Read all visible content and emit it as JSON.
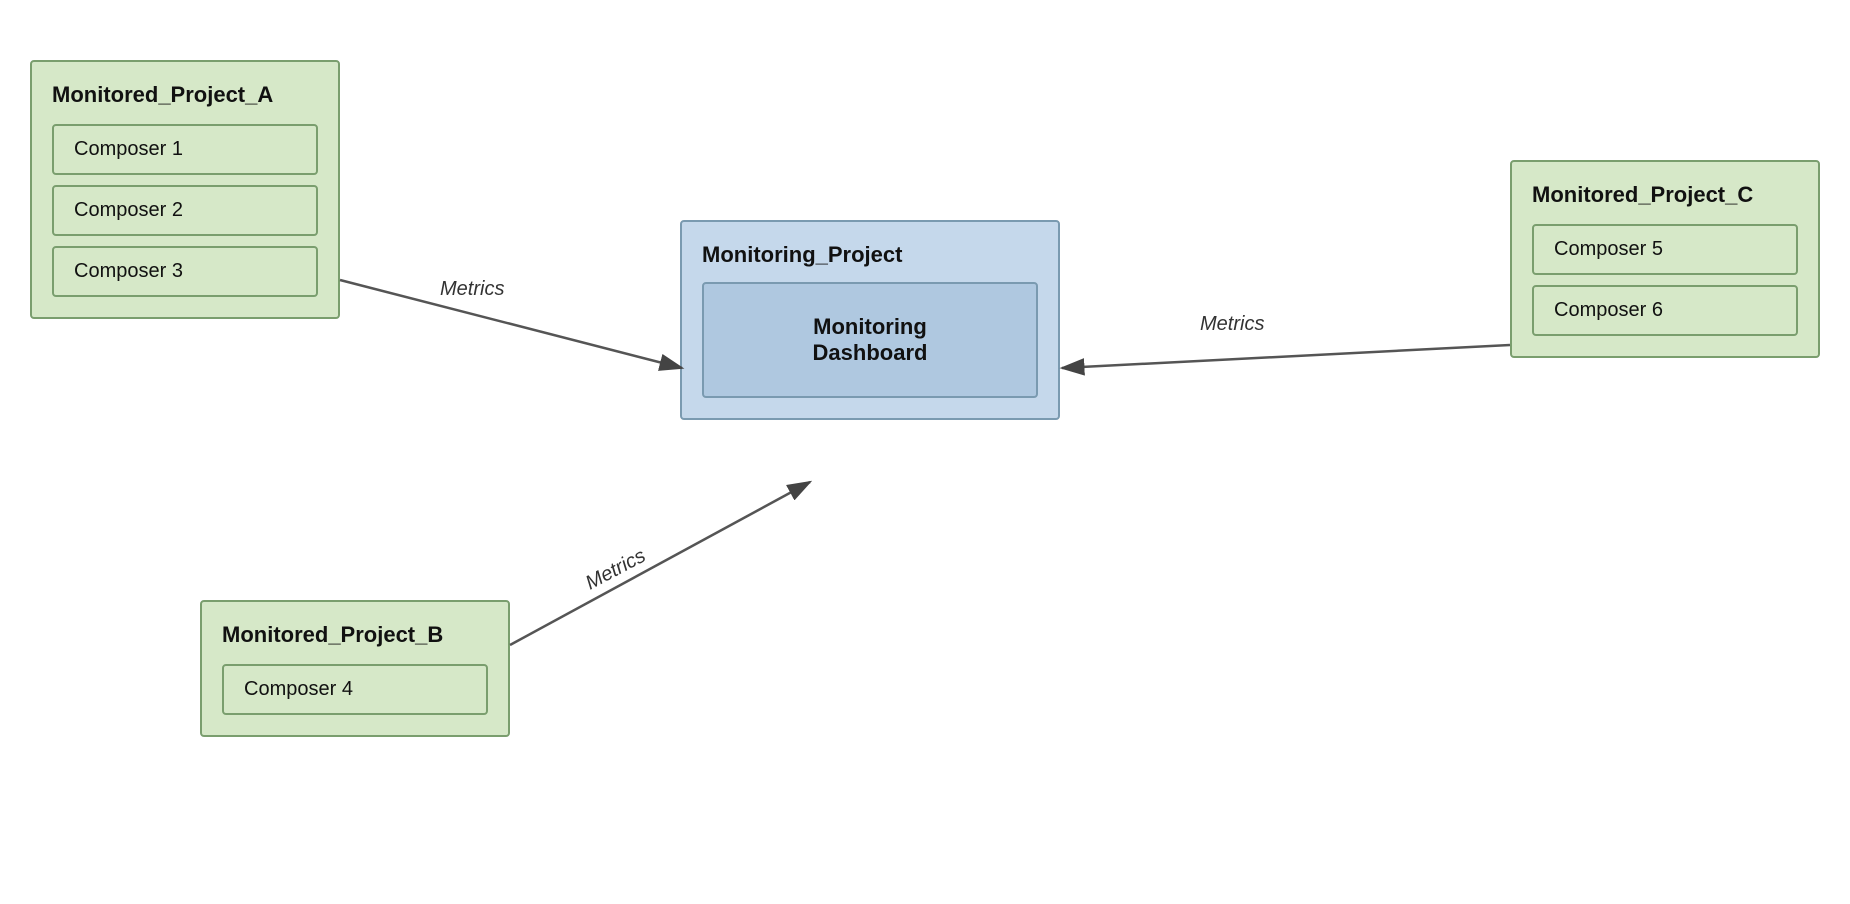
{
  "projects": {
    "project_a": {
      "title": "Monitored_Project_A",
      "composers": [
        "Composer 1",
        "Composer 2",
        "Composer 3"
      ]
    },
    "project_b": {
      "title": "Monitored_Project_B",
      "composers": [
        "Composer 4"
      ]
    },
    "project_c": {
      "title": "Monitored_Project_C",
      "composers": [
        "Composer 5",
        "Composer 6"
      ]
    },
    "monitoring": {
      "title": "Monitoring_Project",
      "dashboard": "Monitoring\nDashboard"
    }
  },
  "arrows": {
    "metrics_label": "Metrics"
  }
}
